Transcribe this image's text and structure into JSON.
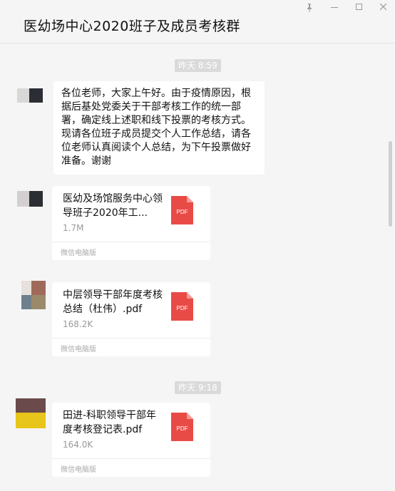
{
  "window": {
    "title": "医幼场中心2020班子及成员考核群",
    "controls": [
      "pin-icon",
      "minimize-icon",
      "maximize-icon",
      "close-icon"
    ]
  },
  "messages": {
    "ts1": "昨天 8:59",
    "msg1_text": "各位老师，大家上午好。由于疫情原因，根据后基处党委关于干部考核工作的统一部署，确定线上述职和线下投票的考核方式。现请各位班子成员提交个人工作总结，请各位老师认真阅读个人总结，为下午投票做好准备。谢谢",
    "file1": {
      "name": "医幼及场馆服务中心领导班子2020年工...",
      "size": "1.7M",
      "icon_label": "PDF",
      "source": "微信电脑版"
    },
    "file2": {
      "name": "中层领导干部年度考核总结（杜伟）.pdf",
      "size": "168.2K",
      "icon_label": "PDF",
      "source": "微信电脑版"
    },
    "ts2": "昨天 9:18",
    "file3": {
      "name": "田进-科职领导干部年度考核登记表.pdf",
      "size": "164.0K",
      "icon_label": "PDF",
      "source": "微信电脑版"
    }
  },
  "colors": {
    "pdf_red": "#e84b45",
    "timestamp_bg": "#dadada",
    "bg": "#f5f5f5"
  }
}
